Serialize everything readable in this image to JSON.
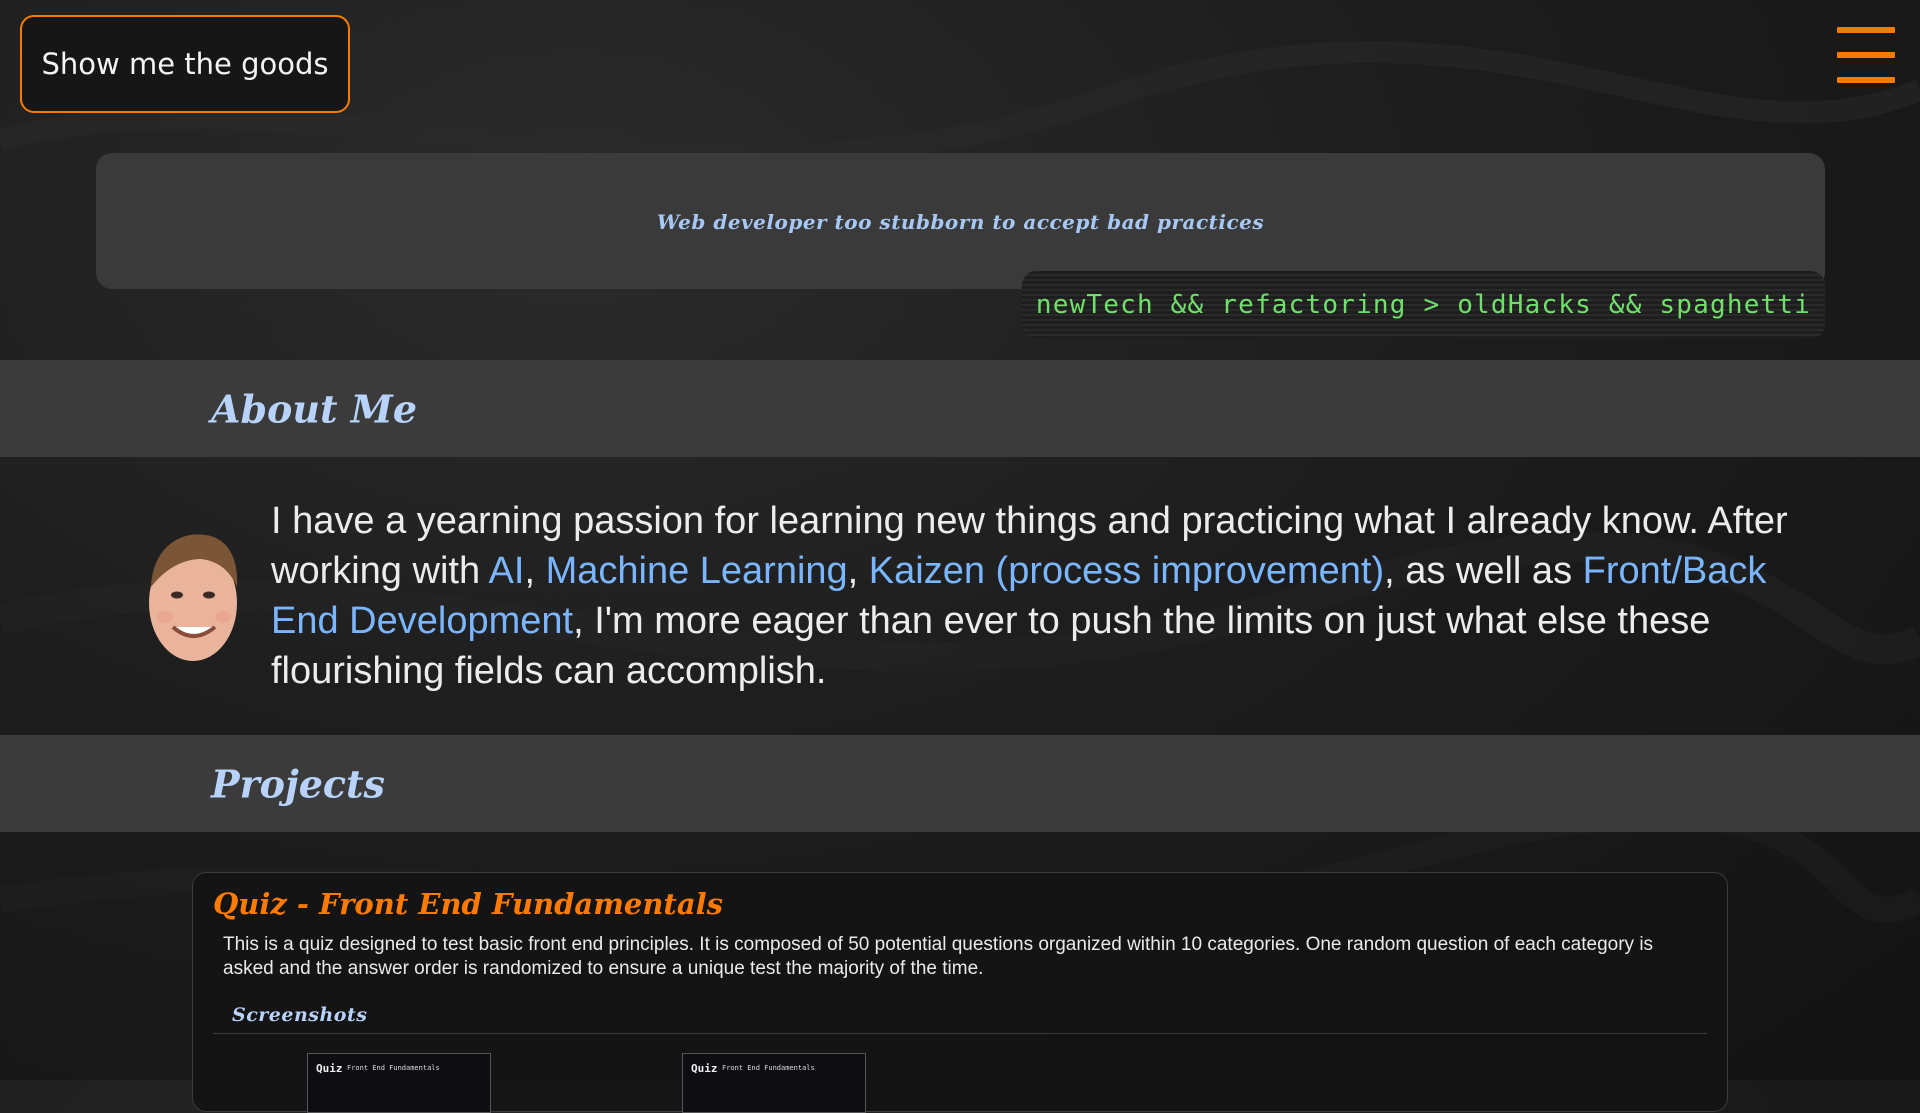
{
  "header": {
    "goods_button_label": "Show me the goods",
    "menu_icon": "hamburger-icon",
    "accent_color": "#f57c00"
  },
  "hero": {
    "tagline": "Web developer too stubborn to accept bad practices",
    "code_line": "newTech && refactoring > oldHacks && spaghetti"
  },
  "about": {
    "heading": "About Me",
    "text_1": "I have a yearning passion for learning new things and practicing what I already know. After working with ",
    "link_ai": "AI",
    "sep_1": ", ",
    "link_ml": "Machine Learning",
    "sep_2": ", ",
    "link_kaizen": "Kaizen (process improvement)",
    "text_2": ", as well as ",
    "link_dev": "Front/Back End Development",
    "text_3": ", I'm more eager than ever to push the limits on just what else these flourishing fields can accomplish."
  },
  "projects": {
    "heading": "Projects",
    "items": [
      {
        "title": "Quiz - Front End Fundamentals",
        "description": "This is a quiz designed to test basic front end principles. It is composed of 50 potential questions organized within 10 categories. One random question of each category is asked and the answer order is randomized to ensure a unique test the majority of the time.",
        "screenshots_heading": "Screenshots",
        "screenshots": [
          {
            "main": "Quiz",
            "sub": "Front End Fundamentals"
          },
          {
            "main": "Quiz",
            "sub": "Front End Fundamentals"
          }
        ]
      }
    ]
  }
}
